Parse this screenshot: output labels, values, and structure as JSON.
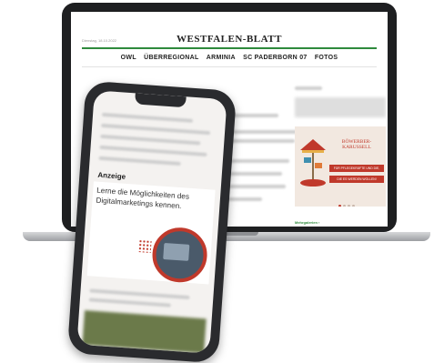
{
  "site": {
    "date": "Dienstag, 18.10.2022",
    "logo": "WESTFALEN-BLATT",
    "nav": [
      "OWL",
      "ÜBERREGIONAL",
      "ARMINIA",
      "SC PADERBORN 07",
      "FOTOS"
    ],
    "link": "Mehrgalerien ›"
  },
  "ad_banner": {
    "title": "BÖWERBER-KARUSSELL",
    "stripe1": "FÜR PFLEGEKRÄFTE UND DIE,",
    "stripe2": "DIE ES WERDEN WOLLEN!"
  },
  "phone": {
    "label": "Anzeige",
    "ad_text": "Lerne die Möglichkeiten des Digitalmarketings kennen."
  },
  "colors": {
    "accent": "#c0392b",
    "rule": "#2e8a3c"
  }
}
